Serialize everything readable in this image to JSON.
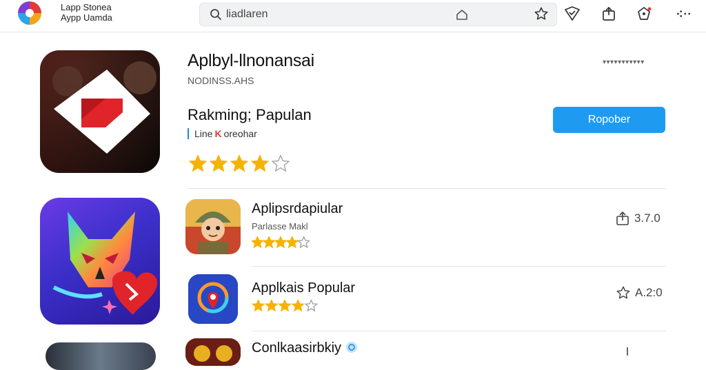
{
  "header": {
    "brand_line1": "Lapp Stonea",
    "brand_line2": "Aypp Uamda",
    "search_placeholder": "liadlaren"
  },
  "featured": {
    "title": "Aplbyl-llnonansai",
    "subtitle": "NODINSS.AHS",
    "meta": "▾▾▾▾▾▾▾▾▾▾▾",
    "ranking": "Rakming; Papulan",
    "line_label": "Line",
    "line_k": "K",
    "line_rest": "oreohar",
    "rating": 4,
    "rating_max": 5,
    "button_label": "Ropober"
  },
  "list": [
    {
      "title": "Aplipsrdapiular",
      "subtitle": "Parlasse Makl",
      "rating": 4,
      "rating_max": 5,
      "right_text": "3.7.0",
      "right_icon": "share-icon"
    },
    {
      "title": "Applkais Popular",
      "subtitle": "",
      "rating": 4,
      "rating_max": 5,
      "right_text": "A.2:0",
      "right_icon": "star-outline-icon"
    },
    {
      "title": "Conlkaasirbkiy",
      "subtitle": "",
      "rating": 0,
      "rating_max": 5,
      "right_text": "",
      "right_icon": "arrow-icon"
    }
  ],
  "colors": {
    "accent": "#1e9bf0",
    "star": "#f5b301",
    "star_empty": "#9e9e9e"
  }
}
